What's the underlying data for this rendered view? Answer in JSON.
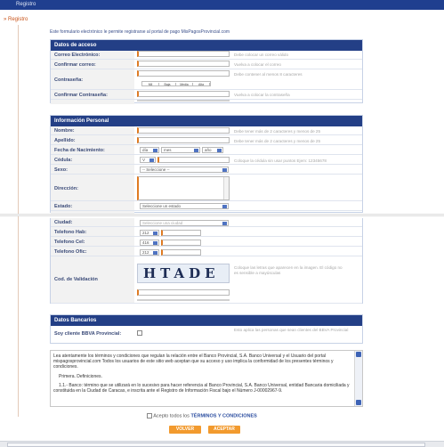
{
  "header": {
    "title": "Registro"
  },
  "breadcrumb": {
    "label": "Registro"
  },
  "intro": "Este formulario electrónico le permite registrarse al portal de pago MisPagosProvincial.com",
  "access": {
    "title": "Datos de acceso",
    "email_label": "Correo Electrónico:",
    "email_hint": "Debe colocar un correo válido",
    "confirm_email_label": "Confirmar correo:",
    "confirm_email_hint": "Vuelva a colocar el correo",
    "password_label": "Contraseña:",
    "password_hint": "Debe contener al menos 8 caracteres",
    "strength": [
      "Mil",
      "Baja",
      "Media",
      "Alta"
    ],
    "confirm_password_label": "Confirmar Contraseña:",
    "confirm_password_hint": "Vuelva a colocar la contraseña"
  },
  "personal": {
    "title": "Información Personal",
    "name_label": "Nombre:",
    "name_hint": "Debe tener más de 2 caracteres y menos de 25",
    "surname_label": "Apellido:",
    "surname_hint": "Debe tener más de 2 caracteres y menos de 25",
    "birth_label": "Fecha de Nacimiento:",
    "day": "día",
    "month": "mes",
    "year": "año",
    "id_label": "Cédula:",
    "id_prefix": "V",
    "id_hint": "Coloque la cédula sin usar puntos Ejem: 12345678",
    "sex_label": "Sexo:",
    "sex_value": "-- Seleccione --",
    "address_label": "Dirección:",
    "state_label": "Estado:",
    "state_value": "Seleccione un estado",
    "city_label": "Ciudad:",
    "city_value": "Seleccione una ciudad",
    "home_phone_label": "Telefono Hab:",
    "home_phone_code": "212",
    "cell_label": "Telefono Cel:",
    "cell_code": "416",
    "office_label": "Telefono Ofic:",
    "office_code": "212",
    "captcha_label": "Cod. de Validación",
    "captcha_text": "HTADE",
    "captcha_hint": "Coloque las letras que aparecen en la imagen. El código no es sensible a mayúsculas"
  },
  "bank": {
    "title": "Datos Bancarios",
    "client_label": "Soy cliente BBVA Provincial:",
    "client_hint": "Esto aplica las personas que sean clientes del BBVA Provincial"
  },
  "terms": {
    "p1": "Lea atentamente los términos y condiciones que regulan la relación entre el Banco Provincial, S.A. Banco Universal y el Usuario del portal mispagosprovincial.com Todos los usuarios de este sitio web aceptan que su acceso y uso implica la conformidad de los presentes términos y condiciones.",
    "p2": "Primera. Definiciones.",
    "p3": "1.1.- Banco: término que se utilizará en lo sucesivo para hacer referencia al Banco Provincial, S.A. Banco Universal, entidad Bancaria domiciliada y constituida en la Ciudad de Caracas, e inscrita ante el Registro de Información Fiscal bajo el Número J-00002967-9.",
    "accept_prefix": "Acepto todos los",
    "accept_link": "TÉRMINOS Y CONDICIONES"
  },
  "buttons": {
    "back": "VOLVER",
    "accept": "ACEPTAR"
  },
  "colors": {
    "header": "#233f86",
    "accent": "#e07b22",
    "button": "#f29a2e"
  }
}
